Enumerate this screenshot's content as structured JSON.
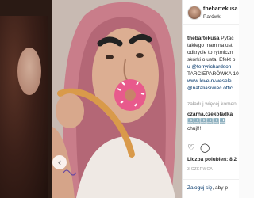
{
  "post": {
    "username": "thebartekusa",
    "location": "Parówki",
    "caption_lines": [
      {
        "user": "thebartekusa",
        "text": "Pytac"
      },
      {
        "text": "takiego mam na ust"
      },
      {
        "text": "odkrycie to rytmiczn"
      },
      {
        "text": "skórki o usta. Efekt p"
      },
      {
        "text": "u @terryrichardson"
      },
      {
        "text": "TARCIEPARÓWKA 10"
      },
      {
        "text": "www.love-n-wesele"
      },
      {
        "text": "@nataliasiwiec.offic"
      }
    ],
    "load_more": "załaduj więcej komen",
    "comment": {
      "user": "czarna.czekoladka",
      "line2": "🔜🔜🔜🔜🔜🔜",
      "line3": "chuj!!!"
    },
    "likes": "Liczba polubień: 8 2",
    "date": "3 CZERWCA",
    "login_link": "Zaloguj się",
    "login_suffix": ", aby p"
  },
  "icons": {
    "like": "heart-icon",
    "comment": "comment-icon",
    "prev": "chevron-left-icon"
  },
  "colors": {
    "link": "#003569",
    "muted": "#999999",
    "text": "#262626",
    "donut": "#e85a8c"
  }
}
